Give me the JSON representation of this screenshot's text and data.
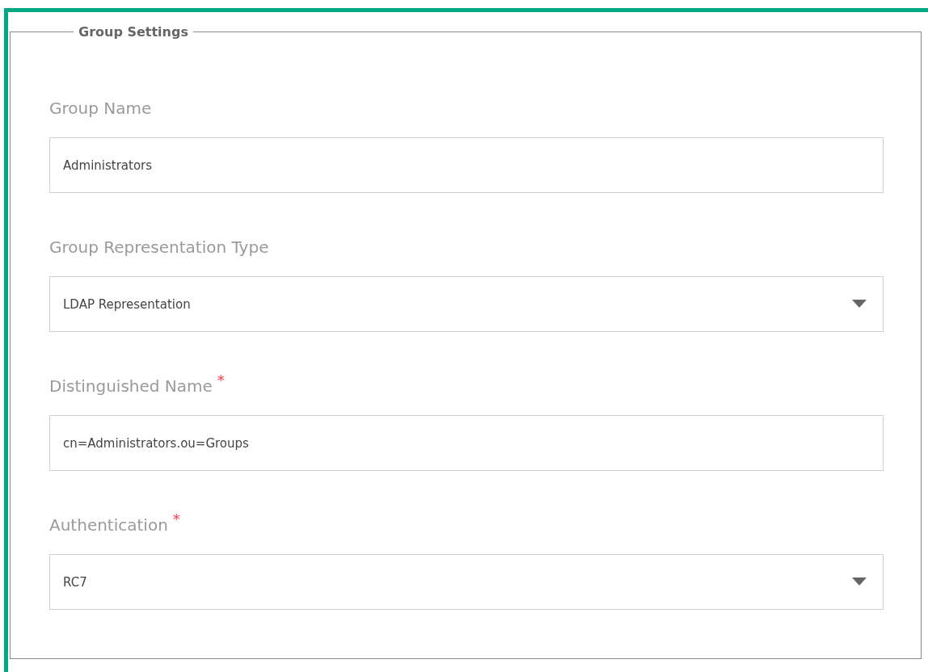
{
  "fieldset": {
    "legend": "Group Settings"
  },
  "fields": [
    {
      "label": "Group Name",
      "kind": "text",
      "value": "Administrators"
    },
    {
      "label": "Group Representation Type",
      "kind": "select",
      "value": "LDAP Representation"
    },
    {
      "label": "Distinguished Name",
      "required_mark": "*",
      "kind": "text",
      "value": "cn=Administrators.ou=Groups"
    },
    {
      "label": "Authentication",
      "required_mark": "*",
      "kind": "select",
      "value": "RC7"
    }
  ]
}
